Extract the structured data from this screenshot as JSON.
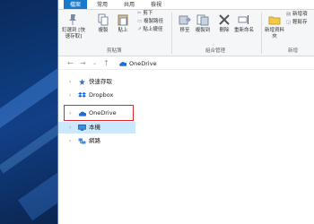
{
  "tabs": [
    "檔案",
    "常用",
    "共用",
    "檢視"
  ],
  "ribbon": {
    "pin_label": "釘選到 [快速存取]",
    "copy_label": "複製",
    "paste_label": "貼上",
    "cut_label": "剪下",
    "copy_path_label": "複製路徑",
    "paste_shortcut_label": "貼上捷徑",
    "clipboard_group": "剪貼簿",
    "move_to_label": "移至",
    "copy_to_label": "複製到",
    "delete_label": "刪除",
    "rename_label": "重新命名",
    "organize_group": "組合管理",
    "new_folder_label": "新增資料夾",
    "new_item_label": "新增項",
    "easy_access_label": "輕鬆存",
    "new_group": "新增"
  },
  "address": {
    "crumb": "OneDrive"
  },
  "nav": {
    "items": [
      {
        "label": "快速存取",
        "icon": "star-icon"
      },
      {
        "label": "Dropbox",
        "icon": "dropbox-icon"
      },
      {
        "label": "OneDrive",
        "icon": "cloud-icon"
      },
      {
        "label": "本機",
        "icon": "computer-icon"
      },
      {
        "label": "網路",
        "icon": "network-icon"
      }
    ]
  },
  "colors": {
    "file_tab": "#1979ca",
    "selected": "#cce8ff",
    "highlight": "#e0262b"
  }
}
